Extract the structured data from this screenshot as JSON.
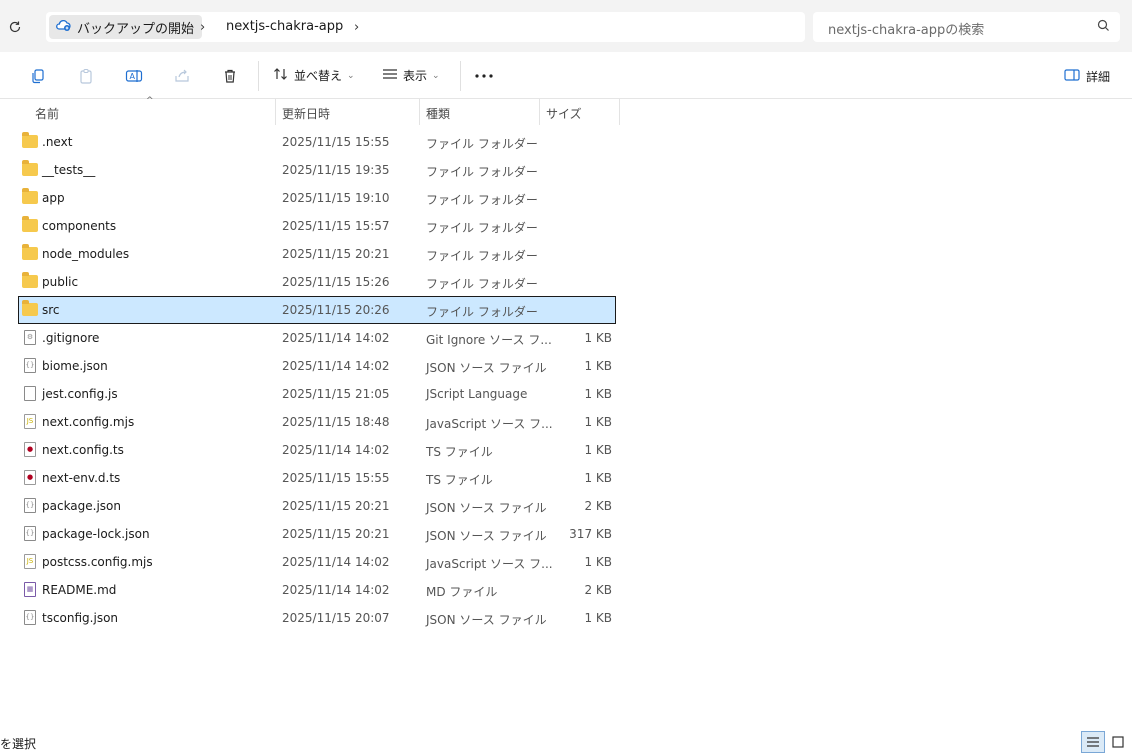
{
  "address": {
    "home_label": "バックアップの開始",
    "folder_label": "nextjs-chakra-app",
    "search_placeholder": "nextjs-chakra-appの検索"
  },
  "toolbar": {
    "sort_label": "並べ替え",
    "view_label": "表示",
    "details_label": "詳細"
  },
  "columns": {
    "name": "名前",
    "date": "更新日時",
    "type": "種類",
    "size": "サイズ"
  },
  "files": [
    {
      "name": ".next",
      "date": "2025/11/15 15:55",
      "type": "ファイル フォルダー",
      "size": "",
      "kind": "folder"
    },
    {
      "name": "__tests__",
      "date": "2025/11/15 19:35",
      "type": "ファイル フォルダー",
      "size": "",
      "kind": "folder"
    },
    {
      "name": "app",
      "date": "2025/11/15 19:10",
      "type": "ファイル フォルダー",
      "size": "",
      "kind": "folder"
    },
    {
      "name": "components",
      "date": "2025/11/15 15:57",
      "type": "ファイル フォルダー",
      "size": "",
      "kind": "folder"
    },
    {
      "name": "node_modules",
      "date": "2025/11/15 20:21",
      "type": "ファイル フォルダー",
      "size": "",
      "kind": "folder"
    },
    {
      "name": "public",
      "date": "2025/11/15 15:26",
      "type": "ファイル フォルダー",
      "size": "",
      "kind": "folder"
    },
    {
      "name": "src",
      "date": "2025/11/15 20:26",
      "type": "ファイル フォルダー",
      "size": "",
      "kind": "folder",
      "selected": true
    },
    {
      "name": ".gitignore",
      "date": "2025/11/14 14:02",
      "type": "Git Ignore ソース フ...",
      "size": "1 KB",
      "kind": "gear"
    },
    {
      "name": "biome.json",
      "date": "2025/11/14 14:02",
      "type": "JSON ソース ファイル",
      "size": "1 KB",
      "kind": "json"
    },
    {
      "name": "jest.config.js",
      "date": "2025/11/15 21:05",
      "type": "JScript Language",
      "size": "1 KB",
      "kind": "doc"
    },
    {
      "name": "next.config.mjs",
      "date": "2025/11/15 18:48",
      "type": "JavaScript ソース フ...",
      "size": "1 KB",
      "kind": "js"
    },
    {
      "name": "next.config.ts",
      "date": "2025/11/14 14:02",
      "type": "TS ファイル",
      "size": "1 KB",
      "kind": "ts"
    },
    {
      "name": "next-env.d.ts",
      "date": "2025/11/15 15:55",
      "type": "TS ファイル",
      "size": "1 KB",
      "kind": "ts"
    },
    {
      "name": "package.json",
      "date": "2025/11/15 20:21",
      "type": "JSON ソース ファイル",
      "size": "2 KB",
      "kind": "json"
    },
    {
      "name": "package-lock.json",
      "date": "2025/11/15 20:21",
      "type": "JSON ソース ファイル",
      "size": "317 KB",
      "kind": "json"
    },
    {
      "name": "postcss.config.mjs",
      "date": "2025/11/14 14:02",
      "type": "JavaScript ソース フ...",
      "size": "1 KB",
      "kind": "js"
    },
    {
      "name": "README.md",
      "date": "2025/11/14 14:02",
      "type": "MD ファイル",
      "size": "2 KB",
      "kind": "md"
    },
    {
      "name": "tsconfig.json",
      "date": "2025/11/15 20:07",
      "type": "JSON ソース ファイル",
      "size": "1 KB",
      "kind": "json"
    }
  ],
  "status": {
    "text": "を選択"
  }
}
